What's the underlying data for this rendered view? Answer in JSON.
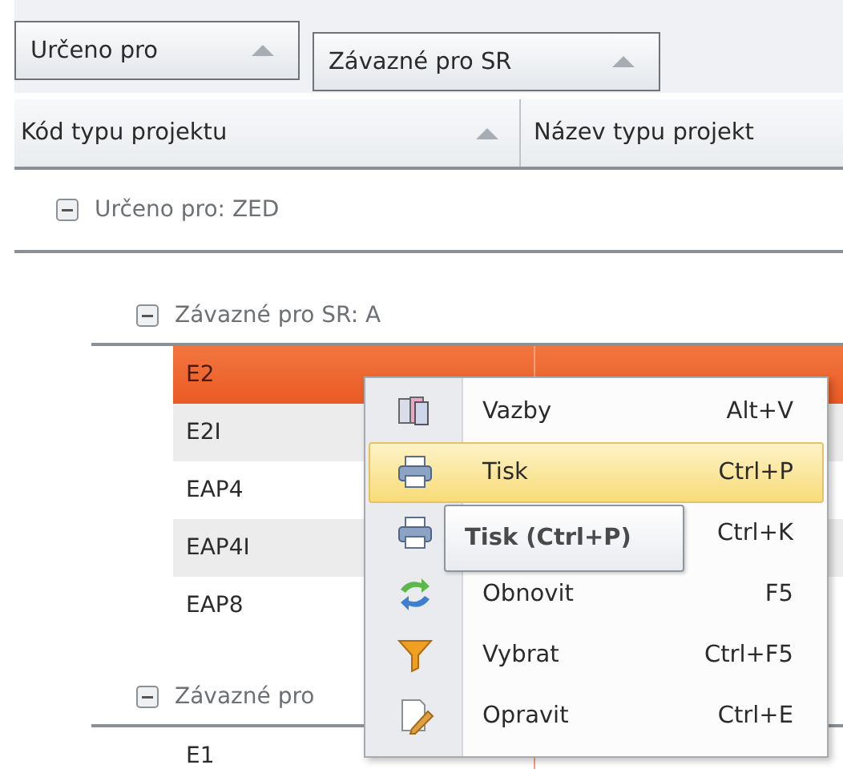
{
  "group_panel": {
    "chips": [
      {
        "label": "Určeno pro"
      },
      {
        "label": "Závazné pro SR"
      }
    ]
  },
  "table": {
    "columns": [
      {
        "label": "Kód typu projektu"
      },
      {
        "label": "Název typu projekt"
      }
    ],
    "groups": [
      {
        "label": "Určeno pro: ZED",
        "expanded": true,
        "children": [
          {
            "label": "Závazné pro SR: A",
            "expanded": true,
            "rows": [
              {
                "code": "E2",
                "selected": true
              },
              {
                "code": "E2I",
                "selected": false
              },
              {
                "code": "EAP4",
                "selected": false
              },
              {
                "code": "EAP4I",
                "selected": false
              },
              {
                "code": "EAP8",
                "selected": false
              }
            ]
          },
          {
            "label": "Závazné pro",
            "expanded": true,
            "rows": [
              {
                "code": "E1",
                "selected": false
              }
            ]
          }
        ]
      }
    ]
  },
  "context_menu": {
    "items": [
      {
        "label": "Vazby",
        "shortcut": "Alt+V",
        "selected": false
      },
      {
        "label": "Tisk",
        "shortcut": "Ctrl+P",
        "selected": true
      },
      {
        "shortcut": "Ctrl+K",
        "selected": false
      },
      {
        "label": "Obnovit",
        "shortcut": "F5",
        "selected": false
      },
      {
        "label": "Vybrat",
        "shortcut": "Ctrl+F5",
        "selected": false
      },
      {
        "label": "Opravit",
        "shortcut": "Ctrl+E",
        "selected": false
      }
    ]
  },
  "tooltip": {
    "text": "Tisk (Ctrl+P)"
  }
}
